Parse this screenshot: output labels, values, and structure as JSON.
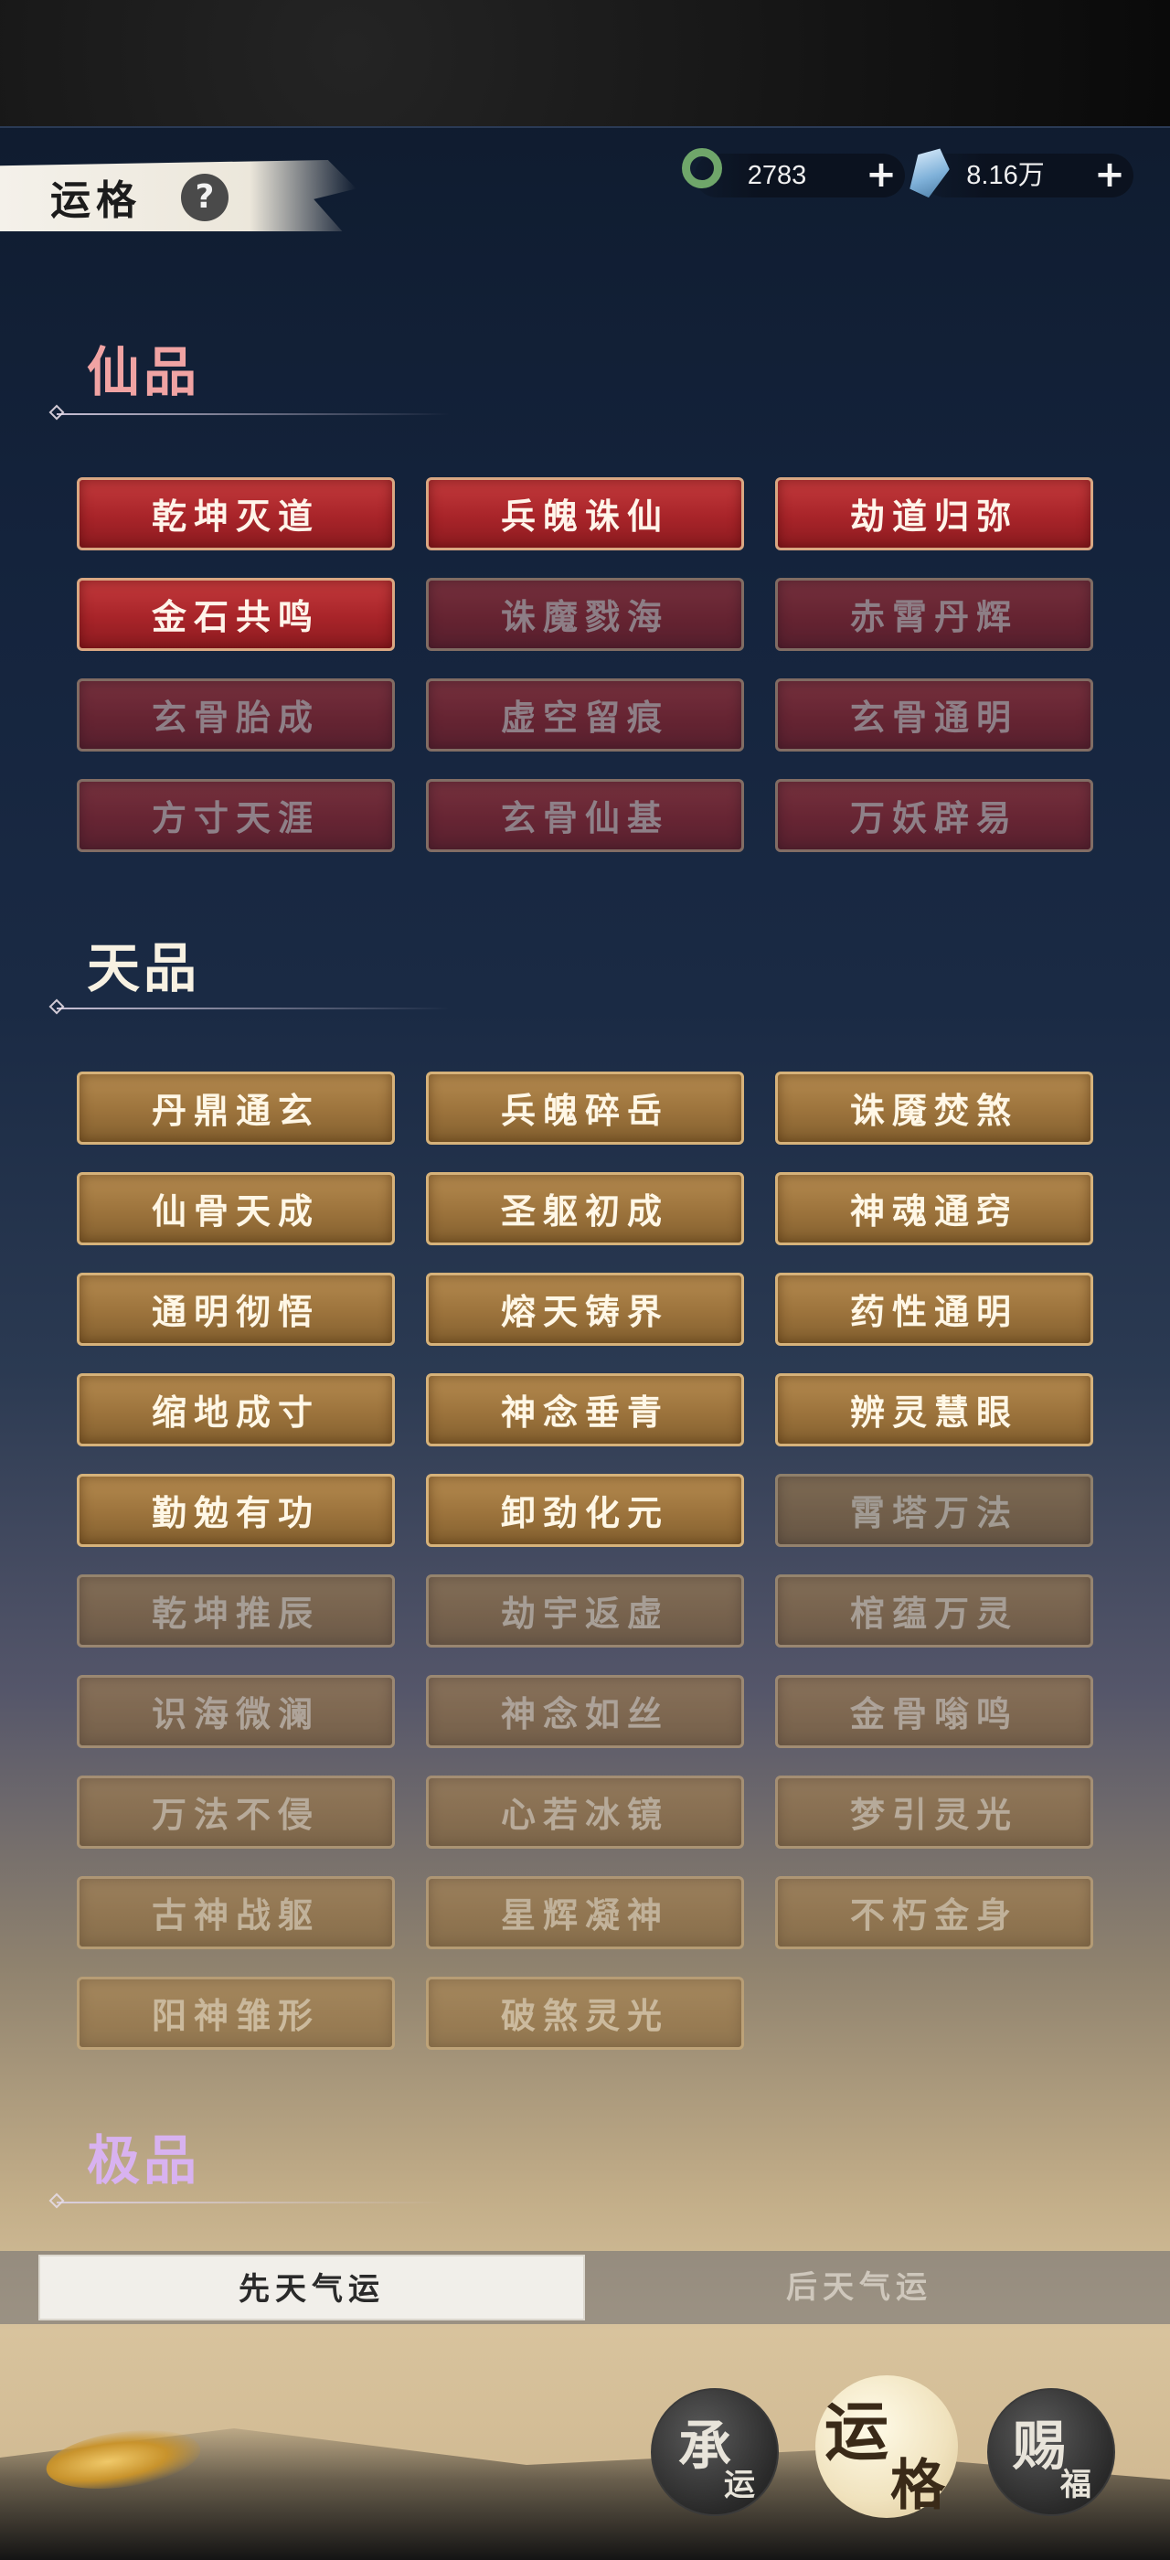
{
  "header": {
    "title": "运格",
    "help_icon": "?",
    "currency": [
      {
        "icon": "jade-ring-icon",
        "value": "2783",
        "plus": "+"
      },
      {
        "icon": "crystal-icon",
        "value": "8.16万",
        "plus": "+"
      }
    ]
  },
  "sections": {
    "xian": {
      "title": "仙品"
    },
    "tian": {
      "title": "天品"
    },
    "ji": {
      "title": "极品"
    }
  },
  "xian_items": [
    {
      "label": "乾坤灭道",
      "active": true
    },
    {
      "label": "兵魄诛仙",
      "active": true
    },
    {
      "label": "劫道归弥",
      "active": true
    },
    {
      "label": "金石共鸣",
      "active": true
    },
    {
      "label": "诛魔戮海",
      "active": false
    },
    {
      "label": "赤霄丹辉",
      "active": false
    },
    {
      "label": "玄骨胎成",
      "active": false
    },
    {
      "label": "虚空留痕",
      "active": false
    },
    {
      "label": "玄骨通明",
      "active": false
    },
    {
      "label": "方寸天涯",
      "active": false
    },
    {
      "label": "玄骨仙基",
      "active": false
    },
    {
      "label": "万妖辟易",
      "active": false
    }
  ],
  "tian_items": [
    {
      "label": "丹鼎通玄",
      "active": true
    },
    {
      "label": "兵魄碎岳",
      "active": true
    },
    {
      "label": "诛魇焚煞",
      "active": true
    },
    {
      "label": "仙骨天成",
      "active": true
    },
    {
      "label": "圣躯初成",
      "active": true
    },
    {
      "label": "神魂通窍",
      "active": true
    },
    {
      "label": "通明彻悟",
      "active": true
    },
    {
      "label": "熔天铸界",
      "active": true
    },
    {
      "label": "药性通明",
      "active": true
    },
    {
      "label": "缩地成寸",
      "active": true
    },
    {
      "label": "神念垂青",
      "active": true
    },
    {
      "label": "辨灵慧眼",
      "active": true
    },
    {
      "label": "勤勉有功",
      "active": true
    },
    {
      "label": "卸劲化元",
      "active": true
    },
    {
      "label": "霄塔万法",
      "active": false
    },
    {
      "label": "乾坤推辰",
      "active": false
    },
    {
      "label": "劫宇返虚",
      "active": false
    },
    {
      "label": "棺蕴万灵",
      "active": false
    },
    {
      "label": "识海微澜",
      "active": false
    },
    {
      "label": "神念如丝",
      "active": false
    },
    {
      "label": "金骨嗡鸣",
      "active": false
    },
    {
      "label": "万法不侵",
      "active": false
    },
    {
      "label": "心若冰镜",
      "active": false
    },
    {
      "label": "梦引灵光",
      "active": false
    },
    {
      "label": "古神战躯",
      "active": false
    },
    {
      "label": "星辉凝神",
      "active": false
    },
    {
      "label": "不朽金身",
      "active": false
    },
    {
      "label": "阳神雏形",
      "active": false
    },
    {
      "label": "破煞灵光",
      "active": false
    }
  ],
  "tabs": {
    "active": "先天气运",
    "inactive": "后天气运"
  },
  "nav": {
    "chengyun": {
      "main": "承",
      "sub": "运"
    },
    "yunge": {
      "main": "运",
      "sub": "格"
    },
    "cifu": {
      "main": "赐",
      "sub": "福"
    }
  }
}
